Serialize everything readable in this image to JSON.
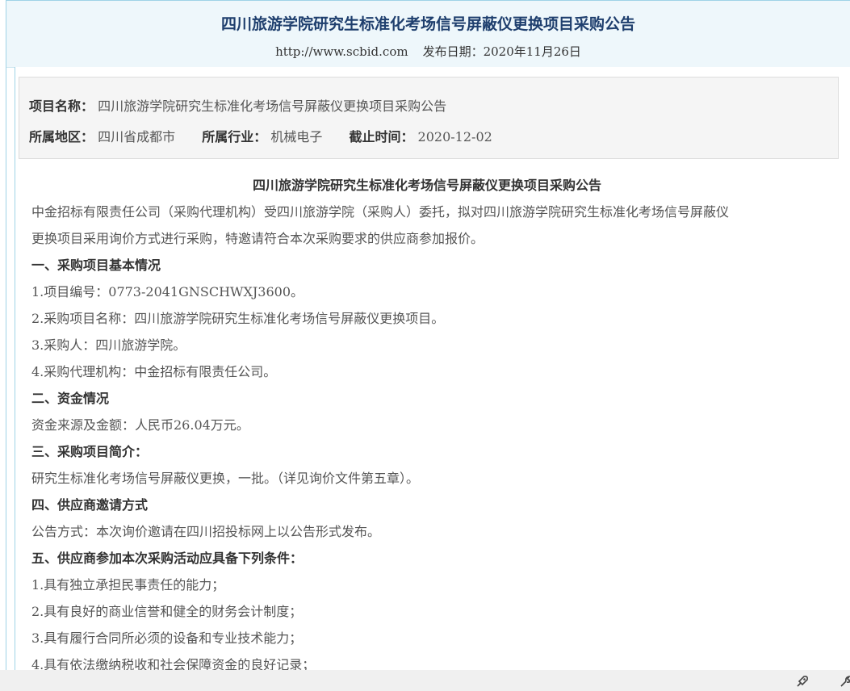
{
  "header": {
    "title": "四川旅游学院研究生标准化考场信号屏蔽仪更换项目采购公告",
    "url": "http://www.scbid.com",
    "publish_date": "发布日期：2020年11月26日"
  },
  "info": {
    "project_label": "项目名称：",
    "project_value": "四川旅游学院研究生标准化考场信号屏蔽仪更换项目采购公告",
    "region_label": "所属地区：",
    "region_value": "四川省成都市",
    "industry_label": "所属行业：",
    "industry_value": "机械电子",
    "deadline_label": "截止时间：",
    "deadline_value": "2020-12-02"
  },
  "article": {
    "title": "四川旅游学院研究生标准化考场信号屏蔽仪更换项目采购公告",
    "intro_line1": "中金招标有限责任公司（采购代理机构）受四川旅游学院（采购人）委托，拟对四川旅游学院研究生标准化考场信号屏蔽仪",
    "intro_line2": "更换项目采用询价方式进行采购，特邀请符合本次采购要求的供应商参加报价。",
    "s1": "一、采购项目基本情况",
    "s1_1": "1.项目编号：0773-2041GNSCHWXJ3600。",
    "s1_2": "2.采购项目名称：四川旅游学院研究生标准化考场信号屏蔽仪更换项目。",
    "s1_3": "3.采购人：四川旅游学院。",
    "s1_4": "4.采购代理机构：中金招标有限责任公司。",
    "s2": "二、资金情况",
    "s2_1": "资金来源及金额：人民币26.04万元。",
    "s3": "三、采购项目简介：",
    "s3_1": "研究生标准化考场信号屏蔽仪更换，一批。（详见询价文件第五章）。",
    "s4": "四、供应商邀请方式",
    "s4_1": "公告方式：本次询价邀请在四川招投标网上以公告形式发布。",
    "s5": "五、供应商参加本次采购活动应具备下列条件：",
    "s5_1": "1.具有独立承担民事责任的能力；",
    "s5_2": "2.具有良好的商业信誉和健全的财务会计制度；",
    "s5_3": "3.具有履行合同所必须的设备和专业技术能力；",
    "s5_4": "4.具有依法缴纳税收和社会保障资金的良好记录；"
  },
  "icons": [
    "rocket-icon",
    "tool-icon"
  ]
}
